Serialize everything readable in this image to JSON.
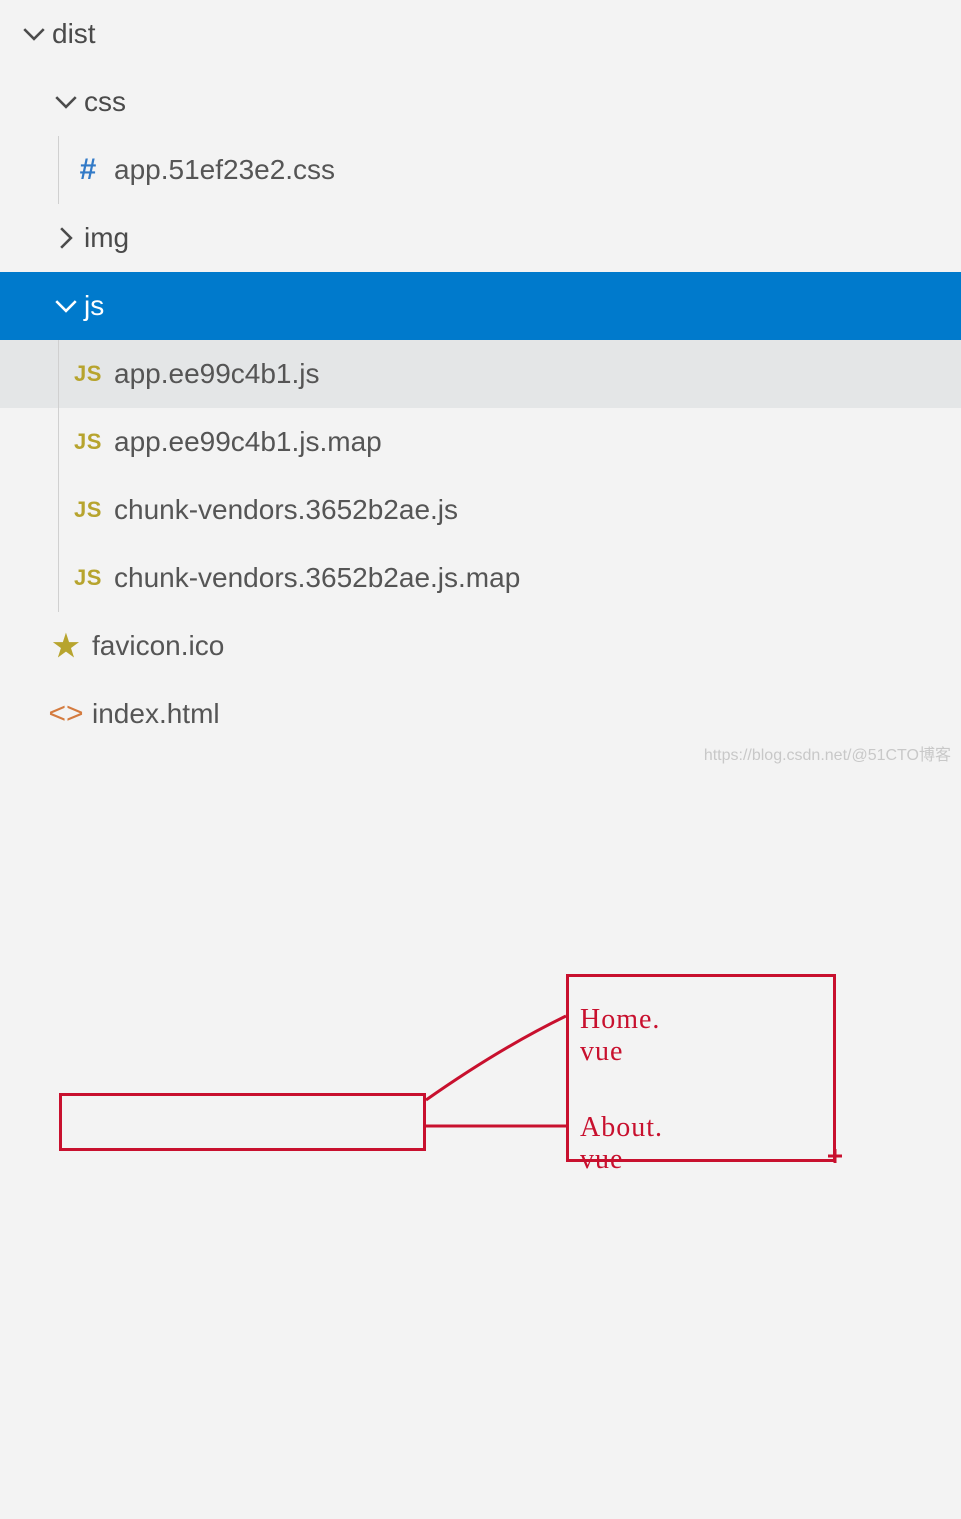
{
  "tree": {
    "dist": {
      "label": "dist"
    },
    "css": {
      "label": "css"
    },
    "css_file": {
      "label": "app.51ef23e2.css"
    },
    "img": {
      "label": "img"
    },
    "js": {
      "label": "js"
    },
    "js_files": [
      {
        "label": "app.ee99c4b1.js"
      },
      {
        "label": "app.ee99c4b1.js.map"
      },
      {
        "label": "chunk-vendors.3652b2ae.js"
      },
      {
        "label": "chunk-vendors.3652b2ae.js.map"
      }
    ],
    "favicon": {
      "label": "favicon.ico"
    },
    "index": {
      "label": "index.html"
    }
  },
  "icons": {
    "hash": "#",
    "js": "JS",
    "star": "★",
    "tag": "<>"
  },
  "annotation": {
    "label1": "Home. vue",
    "label2": "About. vue"
  },
  "watermark": "https://blog.csdn.net/@51CTO博客"
}
